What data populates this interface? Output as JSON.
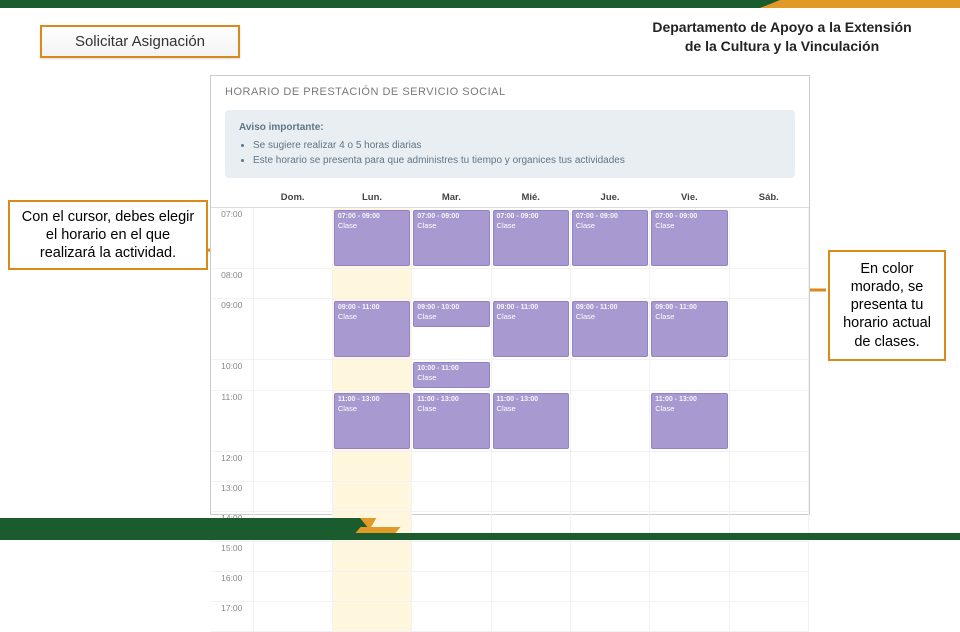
{
  "top": {
    "button_label": "Solicitar Asignación",
    "department_line1": "Departamento de Apoyo a la Extensión",
    "department_line2": "de la Cultura y la Vinculación"
  },
  "callouts": {
    "left_text": "Con el cursor, debes elegir el horario en el que realizará la actividad.",
    "right_text": "En color morado, se presenta tu horario actual de clases."
  },
  "panel": {
    "title": "HORARIO DE PRESTACIÓN DE SERVICIO SOCIAL",
    "notice_heading": "Aviso importante:",
    "notice_bullets": [
      "Se sugiere realizar 4 o 5 horas diarias",
      "Este horario se presenta para que administres tu tiempo y organices tus actividades"
    ]
  },
  "chart_data": {
    "type": "table",
    "title": "Horario de Prestación de Servicio Social",
    "columns": [
      "",
      "Dom.",
      "Lun.",
      "Mar.",
      "Mié.",
      "Jue.",
      "Vie.",
      "Sáb."
    ],
    "row_times": [
      "07:00",
      "08:00",
      "09:00",
      "10:00",
      "11:00",
      "12:00",
      "13:00",
      "14:00",
      "15:00",
      "16:00",
      "17:00"
    ],
    "highlight_column": "Lun.",
    "blocks": [
      {
        "day": "Lun.",
        "start": "07:00",
        "end": "09:00",
        "label": "Clase"
      },
      {
        "day": "Mar.",
        "start": "07:00",
        "end": "09:00",
        "label": "Clase"
      },
      {
        "day": "Mié.",
        "start": "07:00",
        "end": "09:00",
        "label": "Clase"
      },
      {
        "day": "Jue.",
        "start": "07:00",
        "end": "09:00",
        "label": "Clase"
      },
      {
        "day": "Vie.",
        "start": "07:00",
        "end": "09:00",
        "label": "Clase"
      },
      {
        "day": "Lun.",
        "start": "09:00",
        "end": "11:00",
        "label": "Clase"
      },
      {
        "day": "Mar.",
        "start": "09:00",
        "end": "10:00",
        "label": "Clase"
      },
      {
        "day": "Mié.",
        "start": "09:00",
        "end": "11:00",
        "label": "Clase"
      },
      {
        "day": "Jue.",
        "start": "09:00",
        "end": "11:00",
        "label": "Clase"
      },
      {
        "day": "Vie.",
        "start": "09:00",
        "end": "11:00",
        "label": "Clase"
      },
      {
        "day": "Mar.",
        "start": "10:00",
        "end": "11:00",
        "label": "Clase"
      },
      {
        "day": "Lun.",
        "start": "11:00",
        "end": "13:00",
        "label": "Clase"
      },
      {
        "day": "Mar.",
        "start": "11:00",
        "end": "13:00",
        "label": "Clase"
      },
      {
        "day": "Mié.",
        "start": "11:00",
        "end": "13:00",
        "label": "Clase"
      },
      {
        "day": "Vie.",
        "start": "11:00",
        "end": "13:00",
        "label": "Clase"
      }
    ]
  }
}
